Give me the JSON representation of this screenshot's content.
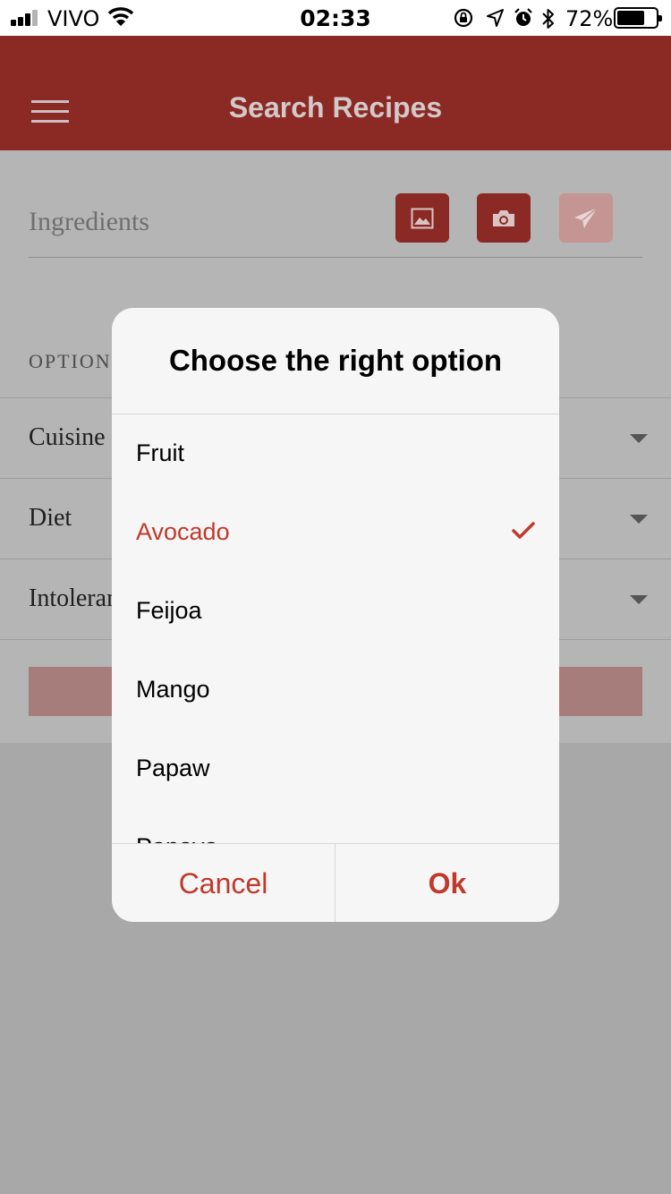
{
  "status_bar": {
    "carrier": "VIVO",
    "time": "02:33",
    "battery_percent": "72%",
    "battery_level": 0.72,
    "signal_bars_filled": 3,
    "icons": [
      "signal-icon",
      "wifi-icon",
      "rotation-lock-icon",
      "location-arrow-icon",
      "alarm-icon",
      "bluetooth-icon",
      "battery-icon"
    ]
  },
  "app_bar": {
    "title": "Search Recipes",
    "menu_icon": "menu-icon"
  },
  "search_form": {
    "ingredients_placeholder": "Ingredients",
    "ingredients_value": "",
    "buttons": [
      {
        "name": "gallery-button",
        "icon": "image-icon"
      },
      {
        "name": "camera-button",
        "icon": "camera-icon"
      },
      {
        "name": "send-button",
        "icon": "paper-plane-icon"
      }
    ],
    "options_heading": "OPTION",
    "selects": [
      {
        "label": "Cuisine"
      },
      {
        "label": "Diet"
      },
      {
        "label": "Intoleran"
      }
    ]
  },
  "dialog": {
    "title": "Choose the right option",
    "options": [
      {
        "label": "Fruit",
        "selected": false
      },
      {
        "label": "Avocado",
        "selected": true
      },
      {
        "label": "Feijoa",
        "selected": false
      },
      {
        "label": "Mango",
        "selected": false
      },
      {
        "label": "Papaw",
        "selected": false
      },
      {
        "label": "Papaya",
        "selected": false
      }
    ],
    "cancel_label": "Cancel",
    "ok_label": "Ok"
  },
  "colors": {
    "brand": "#8b2a25",
    "accent": "#c0392b",
    "overlay_background": "#b5b5b5"
  }
}
